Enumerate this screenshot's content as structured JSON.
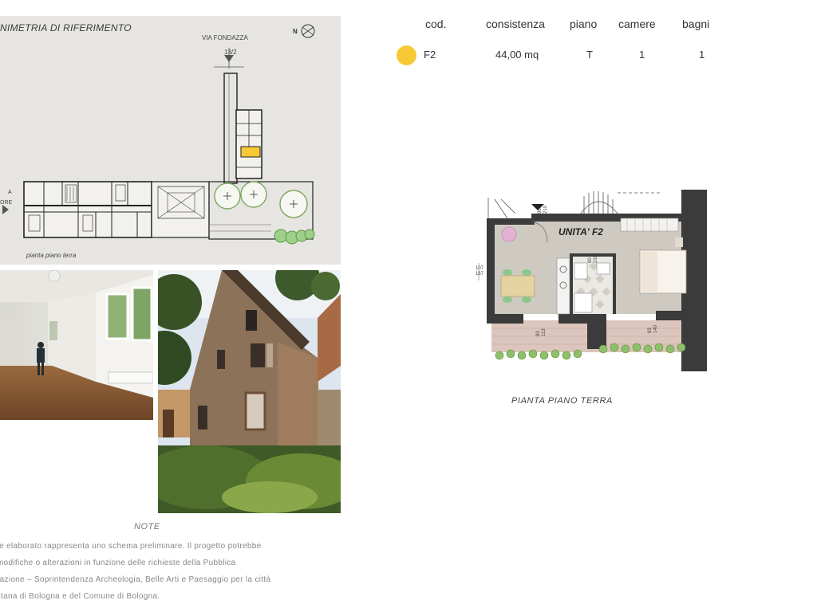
{
  "site_plan": {
    "title": "NIMETRIA DI RIFERIMENTO",
    "street_label": "VIA FONDAZZA",
    "civic_number": "13/2",
    "compass_label": "N",
    "left_label_1": "A",
    "left_label_2": "ORE",
    "caption": "pianta piano terra",
    "highlight_color": "#f7c936"
  },
  "table": {
    "headers": {
      "cod": "cod.",
      "consistenza": "consistenza",
      "piano": "piano",
      "camere": "camere",
      "bagni": "bagni"
    },
    "row": {
      "color": "#f7c936",
      "cod": "F2",
      "consistenza": "44,00 mq",
      "piano": "T",
      "camere": "1",
      "bagni": "1"
    }
  },
  "floor_plan": {
    "unit_label": "UNITA' F2",
    "dim_entry_top": "90",
    "dim_entry_bottom": "210",
    "dim_bath_top": "80",
    "dim_bath_bottom": "210",
    "dim_side_top": "107",
    "dim_side_bottom": "167",
    "dim_win1_top": "83",
    "dim_win1_bottom": "113",
    "dim_win2_top": "83",
    "dim_win2_bottom": "140",
    "caption": "PIANTA PIANO TERRA"
  },
  "notes": {
    "title": "NOTE",
    "lines": [
      "te elaborato rappresenta uno schema preliminare. Il progetto potrebbe",
      "modifiche o alterazioni in funzione delle richieste della Pubblica",
      "razione – Soprintendenza Archeologia, Belle Arti e Paesaggio per la città",
      "litana di Bologna e del Comune di Bologna."
    ]
  },
  "colors": {
    "panel_bg": "#e6e5e1",
    "wall": "#3b3b3b",
    "floor": "#cfcac1",
    "terrace": "#dcc5bc",
    "accent_yellow": "#f7c936"
  }
}
